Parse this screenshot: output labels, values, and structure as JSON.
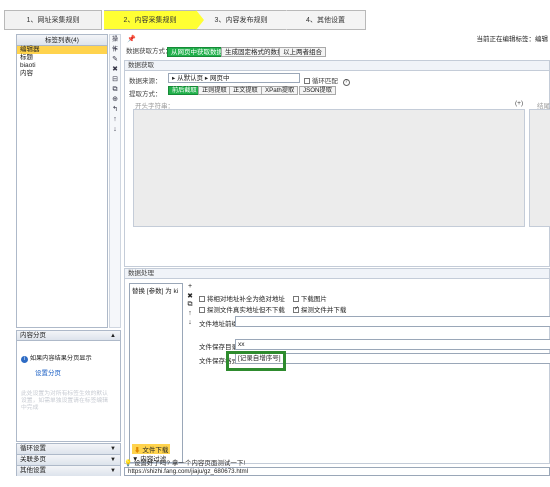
{
  "steps": [
    {
      "label": "1、网址采集规则"
    },
    {
      "label": "2、内容采集规则"
    },
    {
      "label": "3、内容发布规则"
    },
    {
      "label": "4、其他设置"
    }
  ],
  "left": {
    "header": "标签列表(4)",
    "ops_label": "操作",
    "items": [
      "编辑器",
      "标题",
      "biaoti",
      "内容"
    ],
    "tools": [
      "+",
      "✎",
      "✖",
      "⊟",
      "⧉",
      "⊕",
      "↰",
      "↑",
      "↓"
    ]
  },
  "top": {
    "current_label": "当前正在编辑标签：编辑"
  },
  "mode": {
    "label": "数据获取方式：",
    "buttons": [
      "从网页中获取数据",
      "生成固定格式的数据",
      "以上两者组合"
    ]
  },
  "fetch": {
    "header": "数据获取",
    "source_label": "数据来源：",
    "source_path": "▸ 从默认页 ▸ 网页中",
    "loop_label": "循环匹配",
    "extract_label": "提取方式：",
    "extract_buttons": [
      "前后截取",
      "正则提取",
      "正文提取",
      "XPath提取",
      "JSON提取"
    ],
    "start_label": "开头字符串：",
    "plus": "(+)",
    "end_label": "结尾字"
  },
  "proc": {
    "header": "数据处理",
    "items": [
      "替换 [参数] 为 ki",
      "文件下载",
      "内容过滤"
    ],
    "opt1": "将相对地址补全为绝对地址",
    "opt2": "下载图片",
    "opt3": "探测文件真实地址但不下载",
    "opt4": "探测文件并下载",
    "prefix_label": "文件地址前缀",
    "dir_label": "文件保存目录",
    "dir_value": "xx",
    "fmt_label": "文件保存格式",
    "fmt_value": "[记录自增序号]"
  },
  "side": {
    "paging": "内容分页",
    "hint": "如果内容结果分页显示",
    "setup": "设置分页",
    "faded": "此处设置为对所有标签生效的默认设置，如需单独设置请在标签编辑中完成",
    "loop": "循环设置",
    "multipage": "关联多页",
    "other": "其他设置"
  },
  "status": {
    "hint": "设置好了吗? 拿一个内容页面测试一下!",
    "url": "https://shizhi.fang.com/jiaju/gz_680673.html"
  }
}
